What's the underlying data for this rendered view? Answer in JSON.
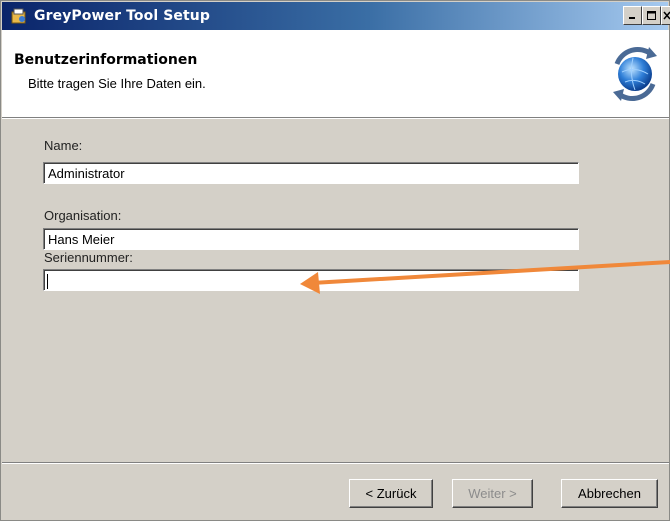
{
  "window": {
    "title": "GreyPower Tool Setup"
  },
  "header": {
    "title": "Benutzerinformationen",
    "subtitle": "Bitte tragen Sie Ihre Daten ein."
  },
  "form": {
    "name_label": "Name:",
    "name_value": "Administrator",
    "organisation_label": "Organisation:",
    "organisation_value": "Hans Meier",
    "serial_label": "Seriennummer:",
    "serial_value": ""
  },
  "buttons": {
    "back": "< Zurück",
    "next": "Weiter >",
    "cancel": "Abbrechen"
  },
  "colors": {
    "annotation_arrow": "#f0883a",
    "titlebar": "#0a246a",
    "dialog_bg": "#d4d0c8"
  },
  "icons": [
    "installer-app-icon",
    "minimize-icon",
    "maximize-icon",
    "close-icon",
    "globe-sync-icon",
    "annotation-arrow"
  ]
}
